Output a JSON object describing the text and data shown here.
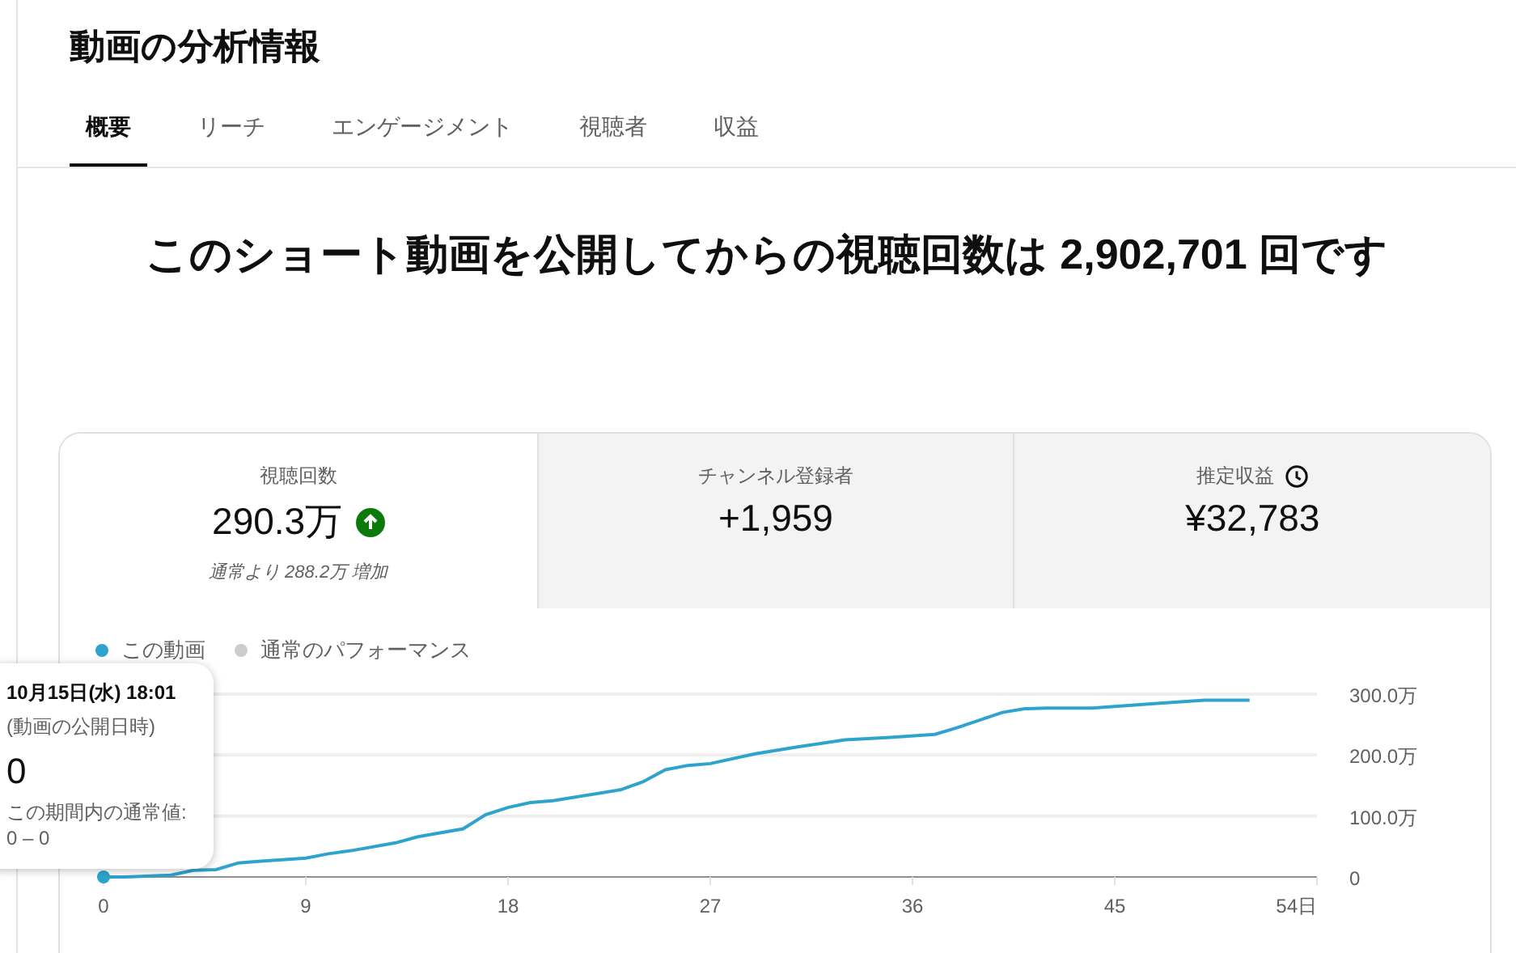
{
  "page_title": "動画の分析情報",
  "tabs": [
    {
      "label": "概要",
      "selected": true
    },
    {
      "label": "リーチ",
      "selected": false
    },
    {
      "label": "エンゲージメント",
      "selected": false
    },
    {
      "label": "視聴者",
      "selected": false
    },
    {
      "label": "収益",
      "selected": false
    }
  ],
  "headline": "このショート動画を公開してからの視聴回数は 2,902,701 回です",
  "metrics": [
    {
      "label": "視聴回数",
      "value": "290.3万",
      "rising": true,
      "note": "通常より 288.2万 増加",
      "selected": true
    },
    {
      "label": "チャンネル登録者",
      "value": "+1,959",
      "selected": false
    },
    {
      "label": "推定収益",
      "value": "¥32,783",
      "clock": true,
      "selected": false
    }
  ],
  "legend": [
    {
      "label": "この動画",
      "color": "#2ea3cd"
    },
    {
      "label": "通常のパフォーマンス",
      "color": "#cccccc"
    }
  ],
  "chart_data": {
    "type": "line",
    "x": [
      0,
      1,
      3,
      4,
      5,
      6,
      7,
      9,
      10,
      11,
      13,
      14,
      16,
      17,
      18,
      19,
      20,
      23,
      24,
      25,
      26,
      27,
      29,
      31,
      33,
      35,
      37,
      38,
      40,
      41,
      42,
      44,
      47,
      49,
      51
    ],
    "series": [
      {
        "color": "#2ea3cd",
        "values": [
          0,
          0,
          3,
          11,
          12,
          23,
          26,
          31,
          38,
          43,
          56,
          66,
          79,
          102,
          114,
          122,
          125,
          143,
          156,
          176,
          183,
          186,
          202,
          214,
          225,
          229,
          234,
          245,
          270,
          276,
          277,
          277,
          285,
          290,
          290
        ]
      }
    ],
    "xlim": [
      0,
      54
    ],
    "ylim": [
      0,
      300
    ],
    "xticks": [
      0,
      9,
      18,
      27,
      36,
      45,
      {
        "value": 54,
        "label": "54日"
      }
    ],
    "yticks": [
      0,
      {
        "value": 100,
        "label": "100.0万"
      },
      {
        "value": 200,
        "label": "200.0万"
      },
      {
        "value": 300,
        "label": "300.0万"
      }
    ]
  },
  "tooltip": {
    "date": "10月15日(水) 18:01",
    "note": "(動画の公開日時)",
    "value": "0",
    "range_label": "この期間内の通常値:",
    "range": "0 – 0"
  }
}
